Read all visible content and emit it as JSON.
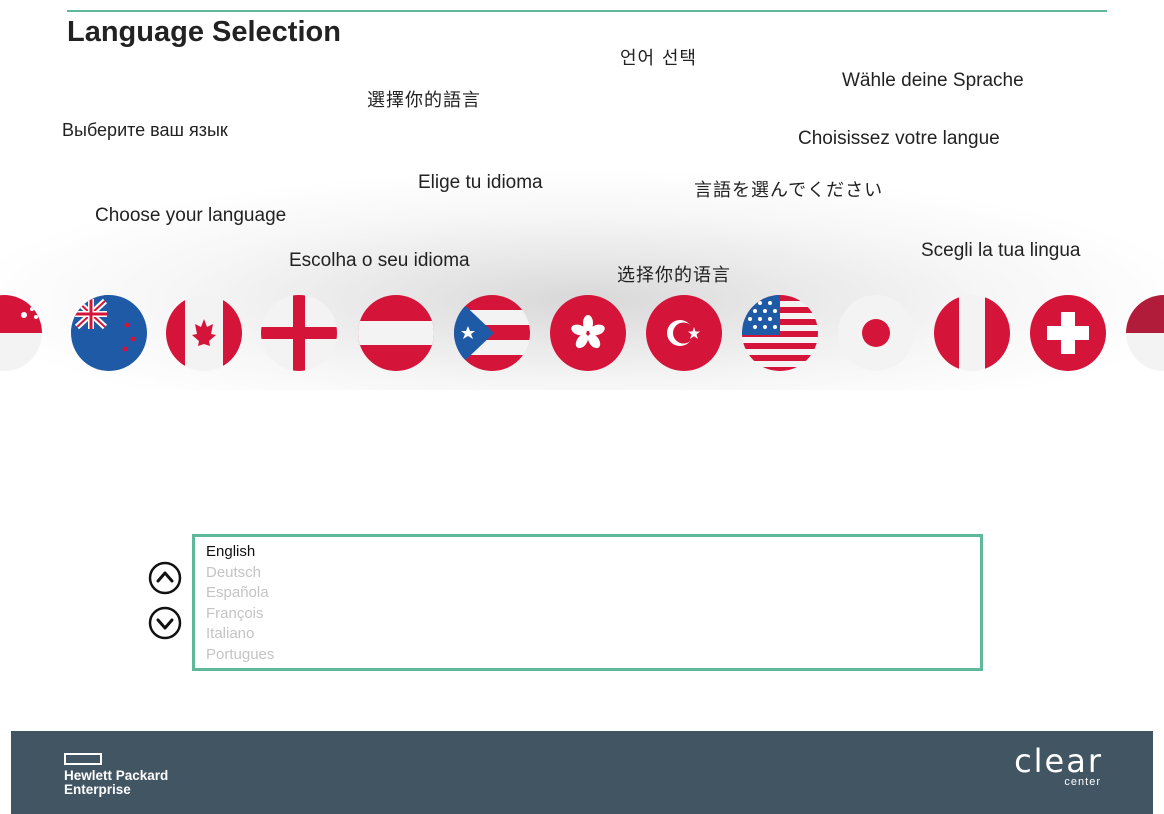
{
  "page_title": "Language Selection",
  "phrases": [
    {
      "id": "korean",
      "text": "언어 선택"
    },
    {
      "id": "german",
      "text": "Wähle deine Sprache"
    },
    {
      "id": "trad-chinese",
      "text": "選擇你的語言"
    },
    {
      "id": "russian",
      "text": "Выберите ваш язык"
    },
    {
      "id": "french",
      "text": "Choisissez votre langue"
    },
    {
      "id": "spanish",
      "text": "Elige tu idioma"
    },
    {
      "id": "japanese",
      "text": "言語を選んでください"
    },
    {
      "id": "english",
      "text": "Choose your language"
    },
    {
      "id": "italian",
      "text": "Scegli la tua lingua"
    },
    {
      "id": "portuguese",
      "text": "Escolha o seu idioma"
    },
    {
      "id": "simp-chinese",
      "text": "选择你的语言"
    }
  ],
  "flags": [
    "singapore-flag-icon",
    "new-zealand-flag-icon",
    "canada-flag-icon",
    "england-flag-icon",
    "austria-flag-icon",
    "puerto-rico-flag-icon",
    "hong-kong-flag-icon",
    "turkey-flag-icon",
    "usa-flag-icon",
    "japan-flag-icon",
    "peru-flag-icon",
    "switzerland-flag-icon",
    "partial-flag-icon"
  ],
  "language_list": {
    "selected": "English",
    "items": [
      "English",
      "Deutsch",
      "Española",
      "François",
      "Italiano",
      "Portugues"
    ]
  },
  "nav": {
    "up_icon": "chevron-up-circle-icon",
    "down_icon": "chevron-down-circle-icon"
  },
  "footer": {
    "hpe_line1": "Hewlett Packard",
    "hpe_line2": "Enterprise",
    "clear_word": "clear",
    "center_word": "center"
  },
  "colors": {
    "accent": "#5fb89a",
    "footer_bg": "#425563",
    "flag_red": "#d5143a",
    "flag_blue": "#1f5aa6"
  }
}
